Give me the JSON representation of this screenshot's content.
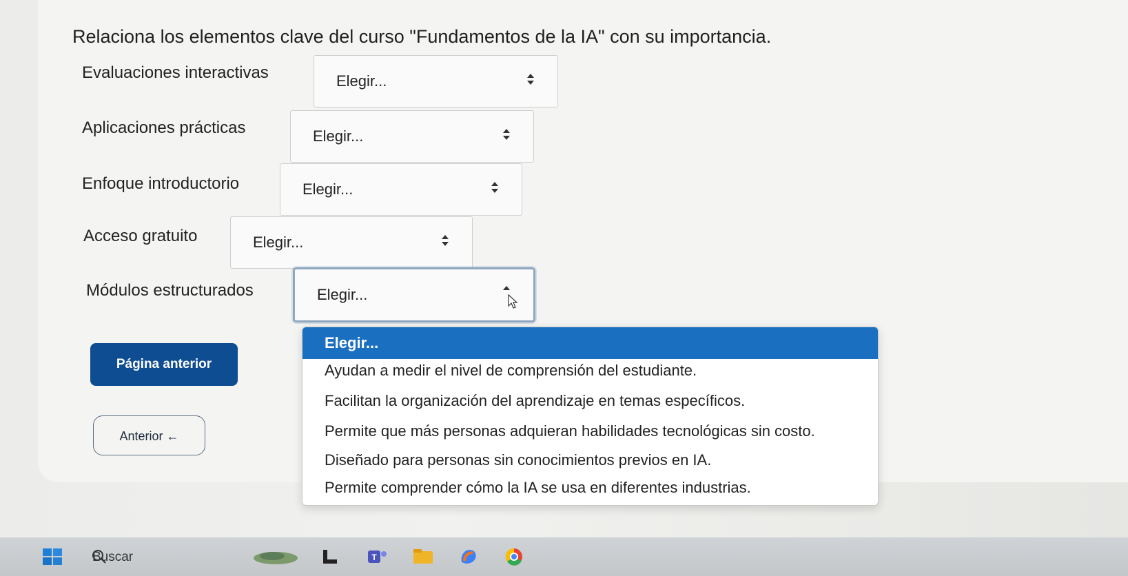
{
  "question": {
    "text": "Relaciona los elementos clave del curso \"Fundamentos de la IA\" con su importancia."
  },
  "rows": [
    {
      "label": "Evaluaciones interactivas",
      "value": "Elegir..."
    },
    {
      "label": "Aplicaciones prácticas",
      "value": "Elegir..."
    },
    {
      "label": "Enfoque introductorio",
      "value": "Elegir..."
    },
    {
      "label": "Acceso gratuito",
      "value": "Elegir..."
    },
    {
      "label": "Módulos estructurados",
      "value": "Elegir..."
    }
  ],
  "dropdown": {
    "options": [
      "Elegir...",
      "Ayudan a medir el nivel de comprensión del estudiante.",
      "Facilitan la organización del aprendizaje en temas específicos.",
      "Permite que más personas adquieran habilidades tecnológicas sin costo.",
      "Diseñado para personas sin conocimientos previos en IA.",
      "Permite comprender cómo la IA se usa en diferentes industrias."
    ],
    "selected_index": 0
  },
  "nav": {
    "prev_page_label": "Página anterior",
    "prev_label": "Anterior ←"
  },
  "taskbar": {
    "search_label": "Buscar",
    "icons": [
      "windows-start-icon",
      "search-icon",
      "widgets-icon",
      "task-view-icon",
      "teams-icon",
      "file-explorer-icon",
      "copilot-icon",
      "chrome-icon"
    ]
  },
  "colors": {
    "primary_button": "#0f4d92",
    "selected_option": "#1a6fc1"
  }
}
